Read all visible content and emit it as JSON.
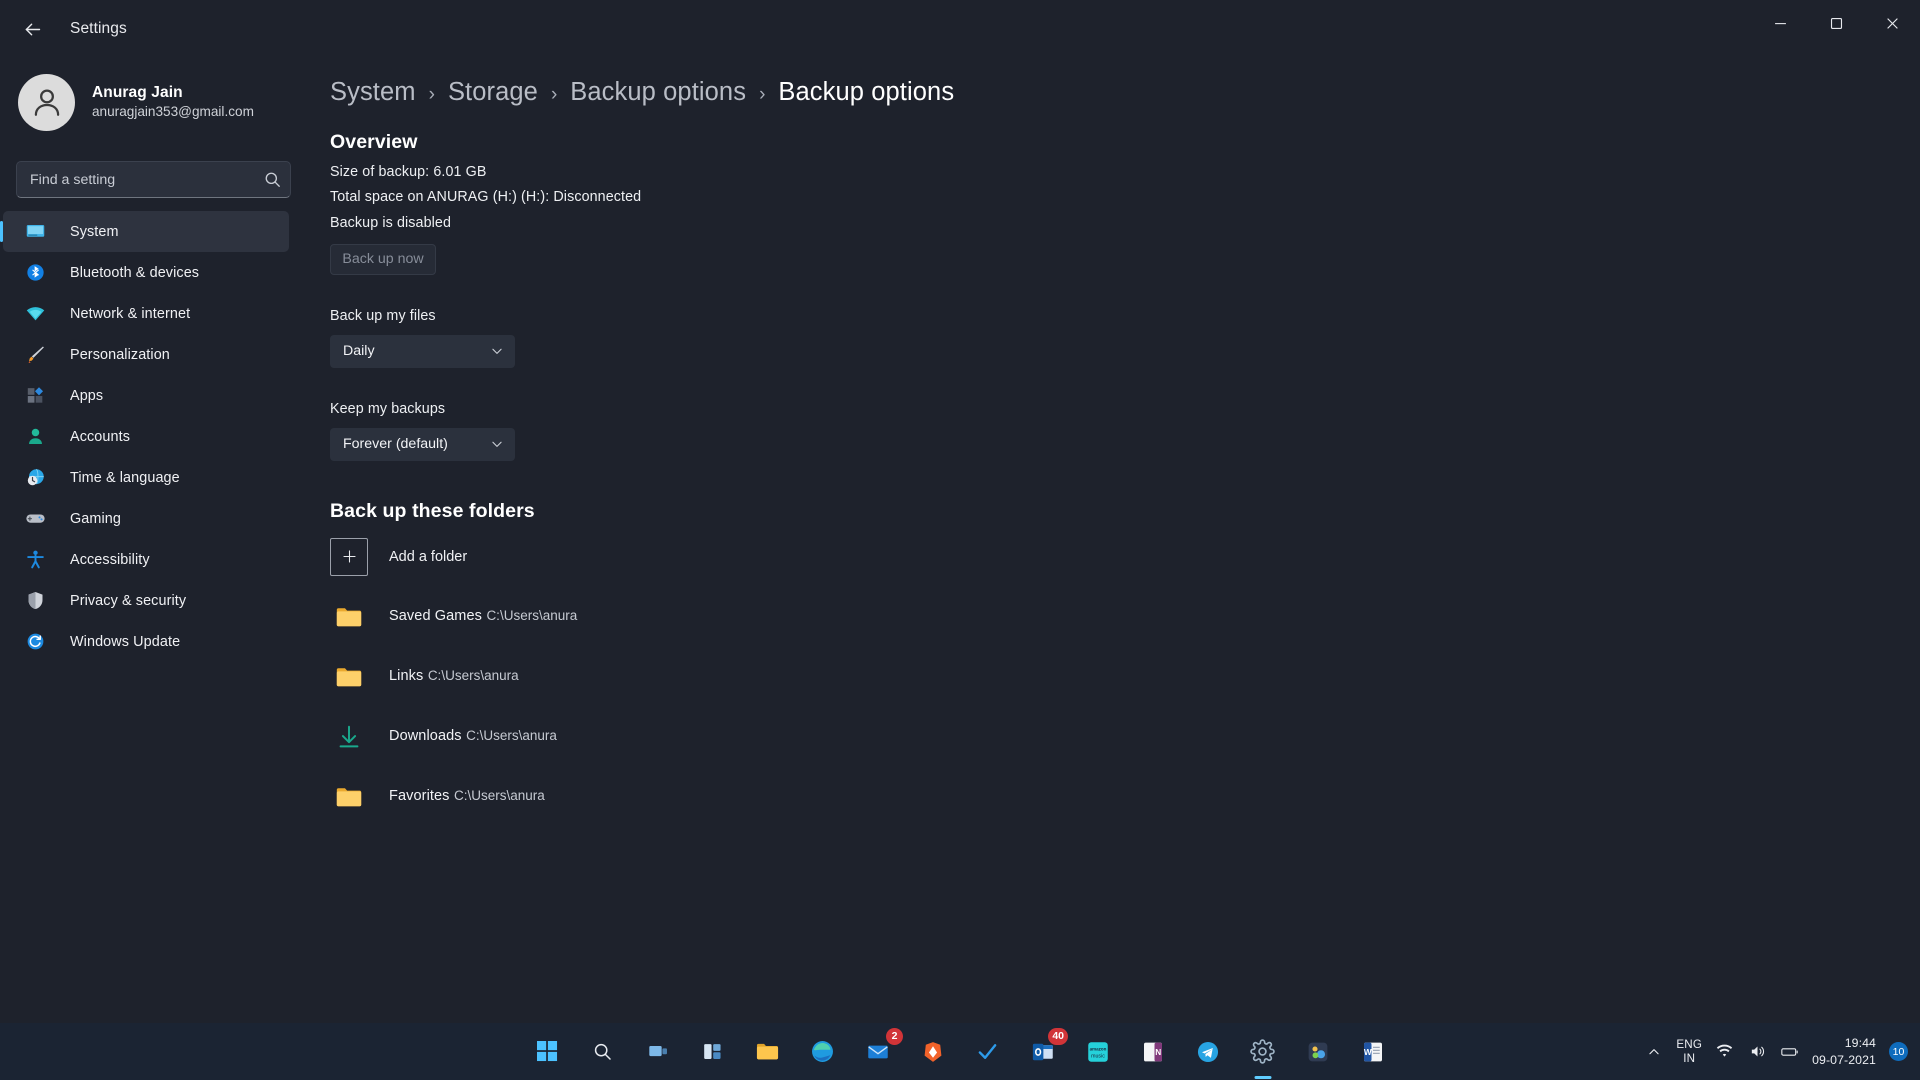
{
  "window": {
    "title": "Settings",
    "back_icon": "back-arrow-icon",
    "minimize_icon": "minimize-icon",
    "maximize_icon": "maximize-icon",
    "close_icon": "close-icon"
  },
  "profile": {
    "name": "Anurag Jain",
    "email": "anuragjain353@gmail.com",
    "avatar_icon": "user-avatar-icon"
  },
  "search": {
    "placeholder": "Find a setting",
    "value": "",
    "icon": "search-icon"
  },
  "sidebar": {
    "items": [
      {
        "label": "System",
        "icon": "system-monitor-icon",
        "active": true
      },
      {
        "label": "Bluetooth & devices",
        "icon": "bluetooth-icon",
        "active": false
      },
      {
        "label": "Network & internet",
        "icon": "wifi-icon",
        "active": false
      },
      {
        "label": "Personalization",
        "icon": "paintbrush-icon",
        "active": false
      },
      {
        "label": "Apps",
        "icon": "apps-icon",
        "active": false
      },
      {
        "label": "Accounts",
        "icon": "accounts-person-icon",
        "active": false
      },
      {
        "label": "Time & language",
        "icon": "clock-globe-icon",
        "active": false
      },
      {
        "label": "Gaming",
        "icon": "gamepad-icon",
        "active": false
      },
      {
        "label": "Accessibility",
        "icon": "accessibility-person-icon",
        "active": false
      },
      {
        "label": "Privacy & security",
        "icon": "shield-icon",
        "active": false
      },
      {
        "label": "Windows Update",
        "icon": "update-refresh-icon",
        "active": false
      }
    ]
  },
  "breadcrumb": {
    "items": [
      "System",
      "Storage",
      "Backup options",
      "Backup options"
    ],
    "separator": "›"
  },
  "overview": {
    "heading": "Overview",
    "size_of_backup": "Size of backup: 6.01 GB",
    "total_space": "Total space on ANURAG (H:) (H:): Disconnected",
    "backup_state": "Backup is disabled",
    "back_up_now_label": "Back up now"
  },
  "settings": {
    "backup_files_label": "Back up my files",
    "backup_files_value": "Daily",
    "keep_backups_label": "Keep my backups",
    "keep_backups_value": "Forever (default)",
    "chevron_icon": "chevron-down-icon"
  },
  "folders": {
    "heading": "Back up these folders",
    "add_label": "Add a folder",
    "add_icon": "plus-icon",
    "items": [
      {
        "name": "Saved Games",
        "path": "C:\\Users\\anura",
        "icon": "folder-icon"
      },
      {
        "name": "Links",
        "path": "C:\\Users\\anura",
        "icon": "folder-icon"
      },
      {
        "name": "Downloads",
        "path": "C:\\Users\\anura",
        "icon": "download-arrow-icon"
      },
      {
        "name": "Favorites",
        "path": "C:\\Users\\anura",
        "icon": "folder-icon"
      }
    ]
  },
  "taskbar": {
    "apps": [
      {
        "name": "start-button",
        "icon": "windows-logo-icon",
        "badge": "",
        "active": false
      },
      {
        "name": "search-button",
        "icon": "search-icon",
        "badge": "",
        "active": false
      },
      {
        "name": "task-view-button",
        "icon": "task-view-icon",
        "badge": "",
        "active": false
      },
      {
        "name": "widgets-button",
        "icon": "widgets-icon",
        "badge": "",
        "active": false
      },
      {
        "name": "file-explorer",
        "icon": "file-explorer-icon",
        "badge": "",
        "active": false
      },
      {
        "name": "microsoft-edge",
        "icon": "edge-icon",
        "badge": "",
        "active": false
      },
      {
        "name": "mail",
        "icon": "mail-icon",
        "badge": "2",
        "active": false
      },
      {
        "name": "brave-browser",
        "icon": "brave-lion-icon",
        "badge": "",
        "active": false
      },
      {
        "name": "todo",
        "icon": "checkmark-icon",
        "badge": "",
        "active": false
      },
      {
        "name": "outlook",
        "icon": "outlook-icon",
        "badge": "40",
        "active": false
      },
      {
        "name": "amazon-music",
        "icon": "amazon-music-icon",
        "badge": "",
        "active": false
      },
      {
        "name": "onenote",
        "icon": "onenote-icon",
        "badge": "",
        "active": false
      },
      {
        "name": "telegram",
        "icon": "telegram-icon",
        "badge": "",
        "active": false
      },
      {
        "name": "settings",
        "icon": "settings-gear-icon",
        "badge": "",
        "active": true
      },
      {
        "name": "photos",
        "icon": "photos-icon",
        "badge": "",
        "active": false
      },
      {
        "name": "word",
        "icon": "word-icon",
        "badge": "",
        "active": false
      }
    ],
    "tray": {
      "chevron_icon": "chevron-up-icon",
      "language_line1": "ENG",
      "language_line2": "IN",
      "wifi_icon": "wifi-icon",
      "volume_icon": "speaker-icon",
      "battery_icon": "battery-icon",
      "time": "19:44",
      "date": "09-07-2021",
      "notification_count": "10"
    }
  }
}
